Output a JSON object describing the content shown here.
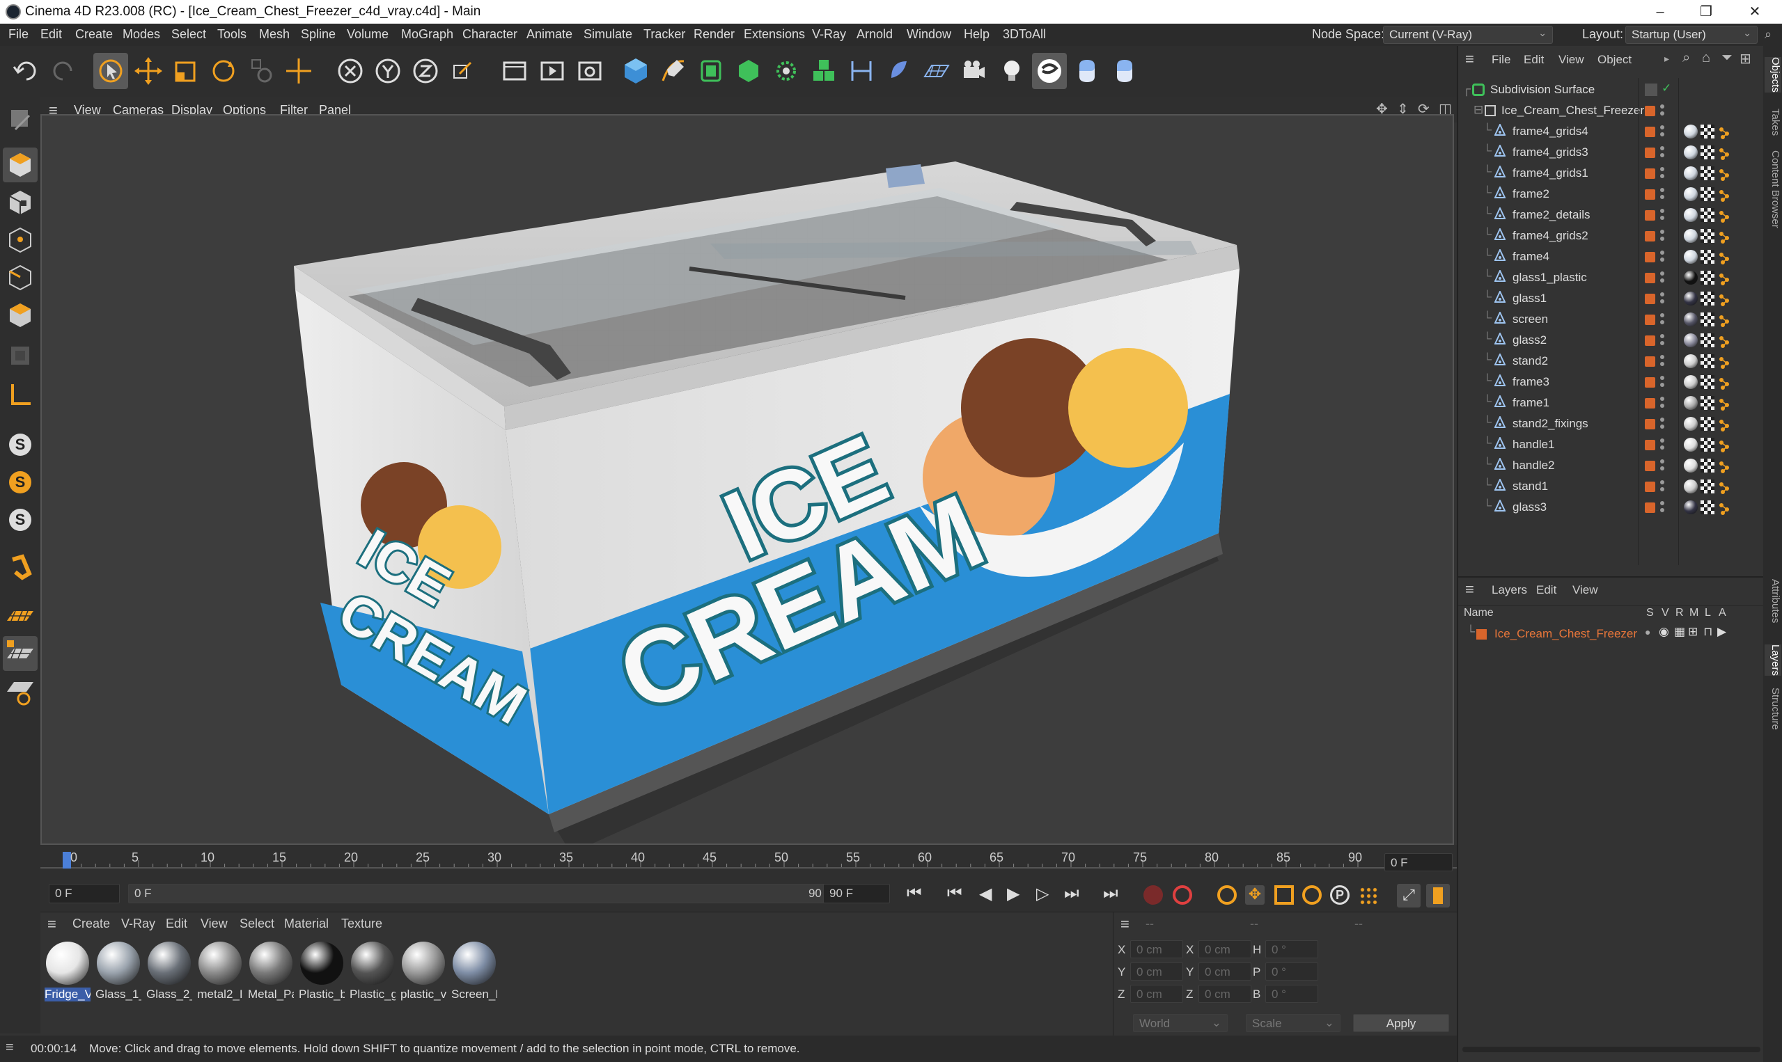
{
  "window": {
    "title": "Cinema 4D R23.008 (RC) - [Ice_Cream_Chest_Freezer_c4d_vray.c4d] - Main",
    "controls": [
      "–",
      "❐",
      "✕"
    ]
  },
  "menubar": {
    "items": [
      "File",
      "Edit",
      "Create",
      "Modes",
      "Select",
      "Tools",
      "Mesh",
      "Spline",
      "Volume",
      "MoGraph",
      "Character",
      "Animate",
      "Simulate",
      "Tracker",
      "Render",
      "Extensions",
      "V-Ray",
      "Arnold",
      "Window",
      "Help",
      "3DToAll"
    ],
    "node_space_label": "Node Space:",
    "node_space_value": "Current (V-Ray)",
    "layout_label": "Layout:",
    "layout_value": "Startup (User)"
  },
  "viewport": {
    "menu": [
      "View",
      "Cameras",
      "Display",
      "Options",
      "Filter",
      "Panel"
    ],
    "scene": {
      "front_text_line1": "ICE",
      "front_text_line2": "CREAM",
      "side_text_line1": "ICE",
      "side_text_line2": "CREAM"
    }
  },
  "timeline": {
    "ticks": [
      "0",
      "5",
      "10",
      "15",
      "20",
      "25",
      "30",
      "35",
      "40",
      "45",
      "50",
      "55",
      "60",
      "65",
      "70",
      "75",
      "80",
      "85",
      "90"
    ],
    "frame_display": "0 F"
  },
  "transport": {
    "start_field": "0 F",
    "range_start": "0 F",
    "range_end": "90 F",
    "end_field": "90 F"
  },
  "material_panel": {
    "menu": [
      "Create",
      "V-Ray",
      "Edit",
      "View",
      "Select",
      "Material",
      "Texture"
    ],
    "materials": [
      {
        "label": "Fridge_V",
        "color": "#e6e6e6"
      },
      {
        "label": "Glass_1_",
        "color": "#9aa3ad"
      },
      {
        "label": "Glass_2_",
        "color": "#6a7078"
      },
      {
        "label": "metal2_I",
        "color": "#8b8b8b"
      },
      {
        "label": "Metal_Pa",
        "color": "#7a7a7a"
      },
      {
        "label": "Plastic_b",
        "color": "#111111"
      },
      {
        "label": "Plastic_g",
        "color": "#555555"
      },
      {
        "label": "plastic_v",
        "color": "#9a9a9a"
      },
      {
        "label": "Screen_I",
        "color": "#7f8ea6"
      }
    ]
  },
  "coord_panel": {
    "header": [
      "--",
      "--",
      "--"
    ],
    "rows": [
      {
        "a": "X",
        "av": "0 cm",
        "b": "X",
        "bv": "0 cm",
        "c": "H",
        "cv": "0 °"
      },
      {
        "a": "Y",
        "av": "0 cm",
        "b": "Y",
        "bv": "0 cm",
        "c": "P",
        "cv": "0 °"
      },
      {
        "a": "Z",
        "av": "0 cm",
        "b": "Z",
        "bv": "0 cm",
        "c": "B",
        "cv": "0 °"
      }
    ],
    "world": "World",
    "scale": "Scale",
    "apply": "Apply"
  },
  "object_panel": {
    "menu": [
      "File",
      "Edit",
      "View",
      "Object"
    ],
    "root": "Subdivision Surface",
    "group": "Ice_Cream_Chest_Freezer",
    "objects": [
      "frame4_grids4",
      "frame4_grids3",
      "frame4_grids1",
      "frame2",
      "frame2_details",
      "frame4_grids2",
      "frame4",
      "glass1_plastic",
      "glass1",
      "screen",
      "glass2",
      "stand2",
      "frame3",
      "frame1",
      "stand2_fixings",
      "handle1",
      "handle2",
      "stand1",
      "glass3"
    ]
  },
  "layer_panel": {
    "menu": [
      "Layers",
      "Edit",
      "View"
    ],
    "columns": {
      "name": "Name",
      "flags": [
        "S",
        "V",
        "R",
        "M",
        "L",
        "A"
      ]
    },
    "layer_name": "Ice_Cream_Chest_Freezer"
  },
  "side_tabs": [
    "Objects",
    "Takes",
    "Content Browser",
    "Attributes",
    "Layers",
    "Structure"
  ],
  "status": {
    "time": "00:00:14",
    "message": "Move: Click and drag to move elements. Hold down SHIFT to quantize movement / add to the selection in point mode, CTRL to remove."
  },
  "colors": {
    "accent": "#d9652b",
    "selection": "#3b5ea8",
    "freezer_blue": "#2a8fd6"
  }
}
